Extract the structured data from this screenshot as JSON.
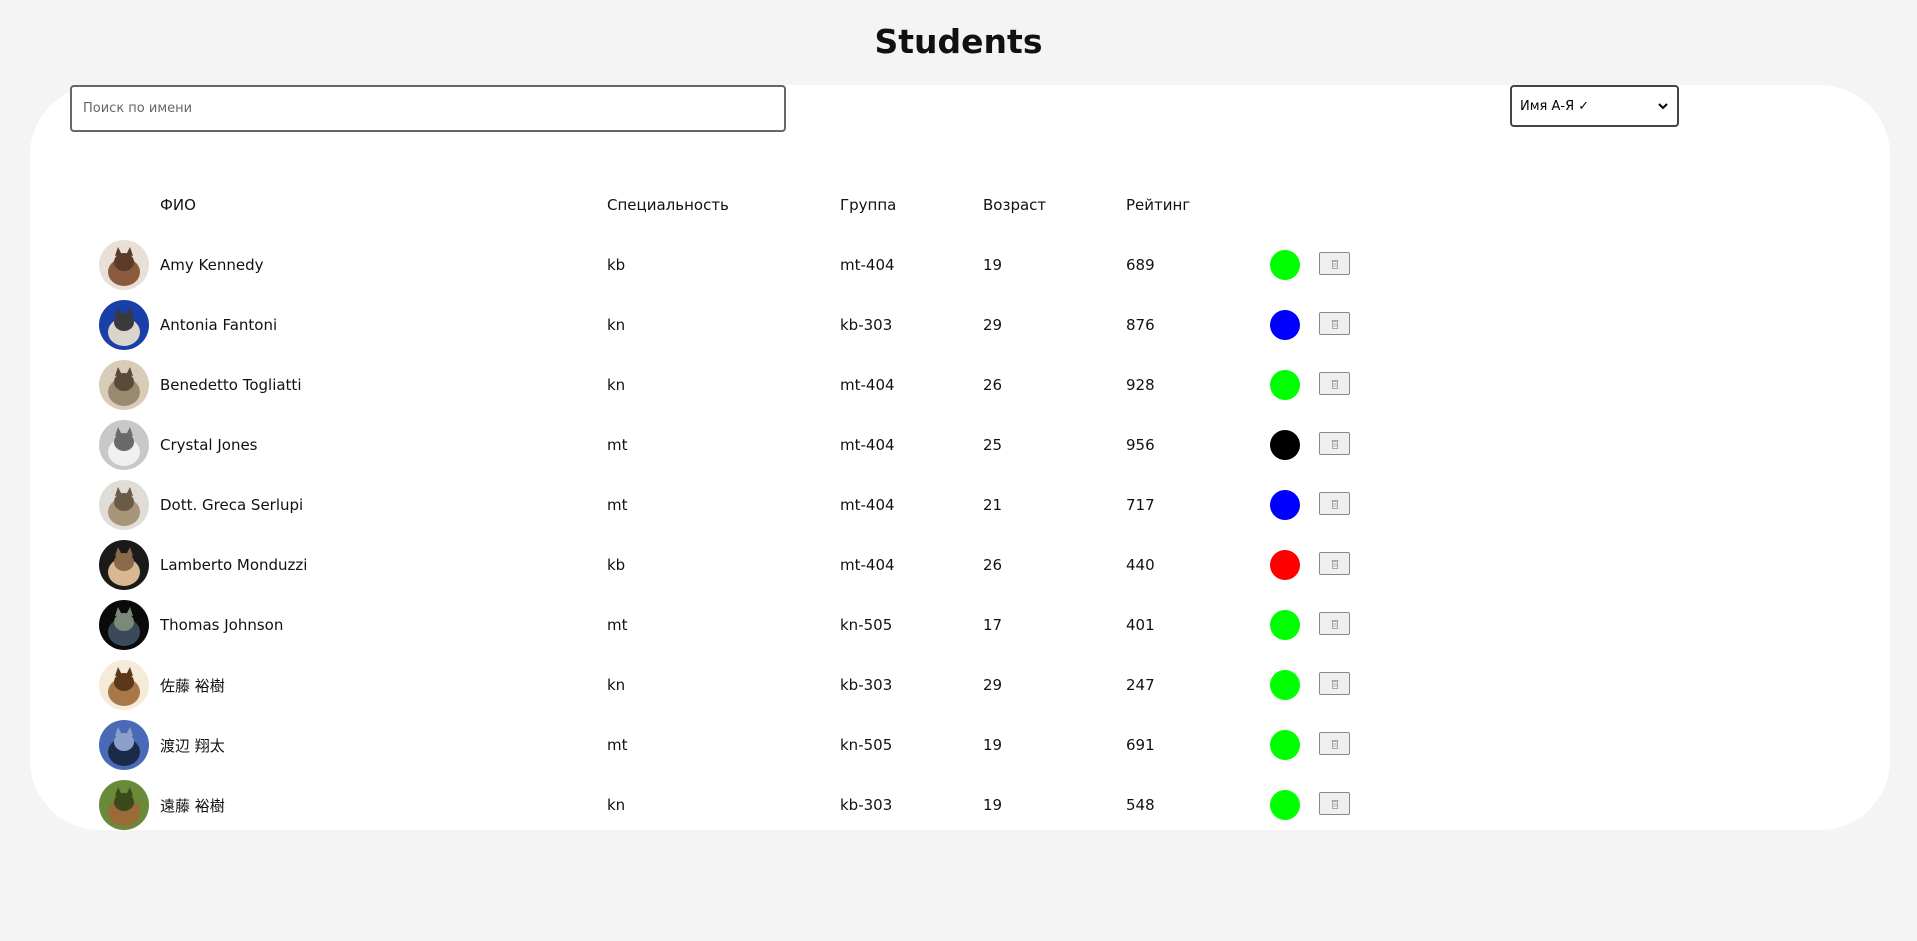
{
  "page": {
    "title": "Students"
  },
  "search": {
    "placeholder": "Поиск по имени",
    "value": ""
  },
  "sort": {
    "selected": "Имя А-Я ✓"
  },
  "table": {
    "headers": {
      "name": "ФИО",
      "specialty": "Специальность",
      "group": "Группа",
      "age": "Возраст",
      "rating": "Рейтинг"
    },
    "rows": [
      {
        "name": "Amy Kennedy",
        "specialty": "kb",
        "group": "mt-404",
        "age": "19",
        "rating": "689",
        "color": "#00ff00",
        "avatar": "cat-photo"
      },
      {
        "name": "Antonia Fantoni",
        "specialty": "kn",
        "group": "kb-303",
        "age": "29",
        "rating": "876",
        "color": "#0000ff",
        "avatar": "cat-photo"
      },
      {
        "name": "Benedetto Togliatti",
        "specialty": "kn",
        "group": "mt-404",
        "age": "26",
        "rating": "928",
        "color": "#00ff00",
        "avatar": "cat-photo"
      },
      {
        "name": "Crystal Jones",
        "specialty": "mt",
        "group": "mt-404",
        "age": "25",
        "rating": "956",
        "color": "#000000",
        "avatar": "cat-photo"
      },
      {
        "name": "Dott. Greca Serlupi",
        "specialty": "mt",
        "group": "mt-404",
        "age": "21",
        "rating": "717",
        "color": "#0000ff",
        "avatar": "cat-photo"
      },
      {
        "name": "Lamberto Monduzzi",
        "specialty": "kb",
        "group": "mt-404",
        "age": "26",
        "rating": "440",
        "color": "#ff0000",
        "avatar": "cat-photo"
      },
      {
        "name": "Thomas Johnson",
        "specialty": "mt",
        "group": "kn-505",
        "age": "17",
        "rating": "401",
        "color": "#00ff00",
        "avatar": "cat-photo"
      },
      {
        "name": "佐藤 裕樹",
        "specialty": "kn",
        "group": "kb-303",
        "age": "29",
        "rating": "247",
        "color": "#00ff00",
        "avatar": "cat-photo"
      },
      {
        "name": "渡辺 翔太",
        "specialty": "mt",
        "group": "kn-505",
        "age": "19",
        "rating": "691",
        "color": "#00ff00",
        "avatar": "cat-photo"
      },
      {
        "name": "遠藤 裕樹",
        "specialty": "kn",
        "group": "kb-303",
        "age": "19",
        "rating": "548",
        "color": "#00ff00",
        "avatar": "cat-photo"
      }
    ]
  }
}
